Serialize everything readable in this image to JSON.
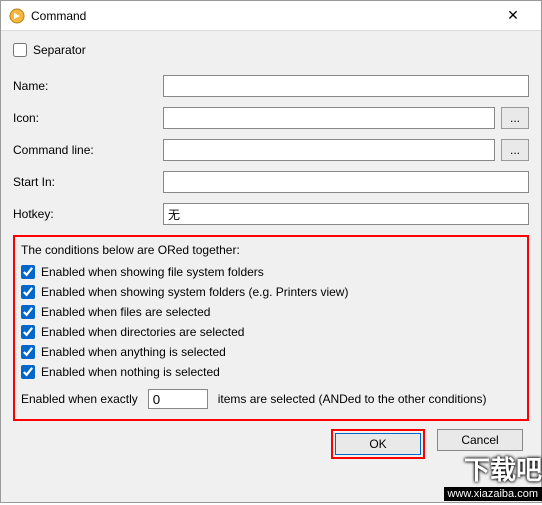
{
  "window": {
    "title": "Command"
  },
  "separator": {
    "label": "Separator",
    "checked": false
  },
  "fields": {
    "name": {
      "label": "Name:",
      "value": ""
    },
    "icon": {
      "label": "Icon:",
      "value": "",
      "browse": "..."
    },
    "commandline": {
      "label": "Command line:",
      "value": "",
      "browse": "..."
    },
    "startin": {
      "label": "Start In:",
      "value": ""
    },
    "hotkey": {
      "label": "Hotkey:",
      "value": "无"
    }
  },
  "conditions": {
    "title": "The conditions below are ORed together:",
    "items": [
      {
        "label": "Enabled when showing file system folders",
        "checked": true
      },
      {
        "label": "Enabled when showing system folders (e.g. Printers view)",
        "checked": true
      },
      {
        "label": "Enabled when files are selected",
        "checked": true
      },
      {
        "label": "Enabled when directories are selected",
        "checked": true
      },
      {
        "label": "Enabled when anything is selected",
        "checked": true
      },
      {
        "label": "Enabled when nothing is selected",
        "checked": true
      }
    ],
    "exact": {
      "prefix": "Enabled when exactly",
      "value": "0",
      "suffix": "items are selected (ANDed to the other conditions)"
    }
  },
  "buttons": {
    "ok": "OK",
    "cancel": "Cancel"
  },
  "watermark": {
    "text": "下载吧",
    "url": "www.xiazaiba.com"
  }
}
